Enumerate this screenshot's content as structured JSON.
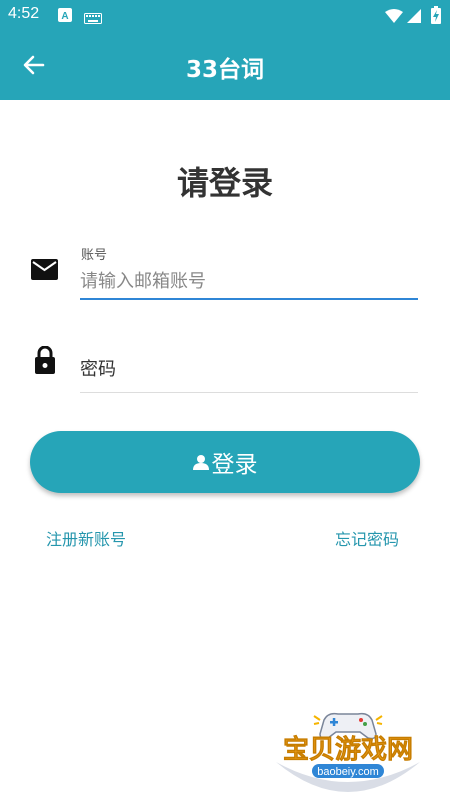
{
  "status_bar": {
    "time": "4:52",
    "left_icons": [
      "text-a-icon",
      "keyboard-icon"
    ],
    "right_icons": [
      "wifi-icon",
      "cell-signal-icon",
      "battery-charging-icon"
    ]
  },
  "app_bar": {
    "title": "33台词",
    "back_icon": "arrow-left-icon"
  },
  "login": {
    "heading": "请登录",
    "account": {
      "label": "账号",
      "placeholder": "请输入邮箱账号",
      "value": "",
      "icon": "mail-icon"
    },
    "password": {
      "placeholder": "密码",
      "value": "",
      "icon": "lock-icon"
    },
    "login_button": {
      "label": "登录",
      "icon": "user-icon"
    },
    "register_link": "注册新账号",
    "forgot_link": "忘记密码"
  },
  "watermark": {
    "text": "宝贝游戏网",
    "url": "baobeiy.com",
    "icon": "gamepad-icon"
  },
  "colors": {
    "primary": "#26a5b8",
    "link": "#2596ad",
    "input_focus": "#2f86d6"
  }
}
